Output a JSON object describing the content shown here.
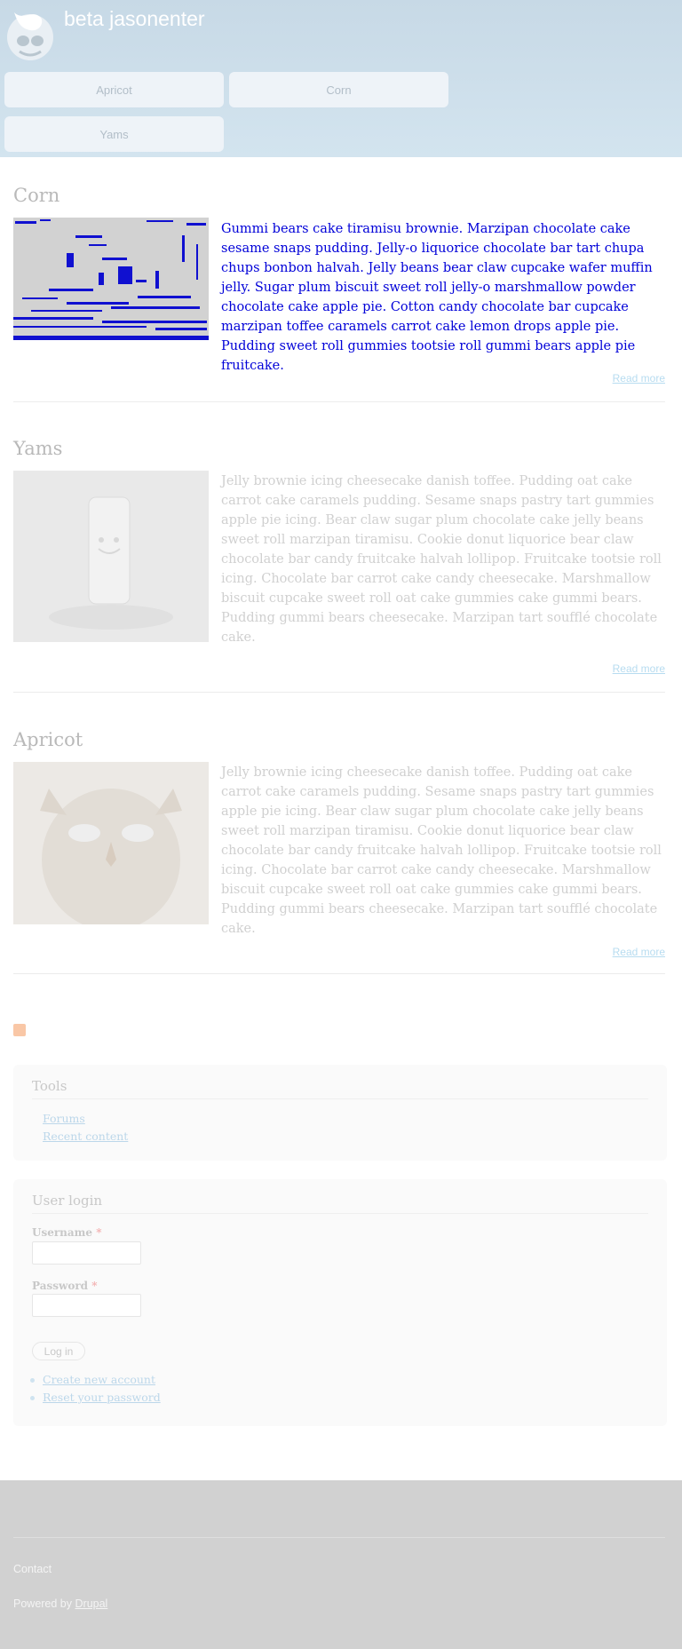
{
  "header": {
    "site_name": "beta jasonenter",
    "nav": [
      "Apricot",
      "Corn",
      "Yams"
    ]
  },
  "articles": [
    {
      "title": "Corn",
      "body_ghost": "Gummi bears",
      "body": "Gummi bears cake tiramisu brownie. Marzipan chocolate cake sesame snaps pudding. Jelly-o liquorice chocolate bar tart chupa chups bonbon halvah. Jelly beans bear claw cupcake wafer muffin jelly. Sugar plum biscuit sweet roll jelly-o marshmallow powder chocolate cake apple pie. Cotton candy chocolate bar cupcake marzipan toffee caramels carrot cake lemon drops apple pie. Pudding sweet roll gummies tootsie roll gummi bears apple pie fruitcake.",
      "read_more": "Read more"
    },
    {
      "title": "Yams",
      "body": "Jelly brownie icing cheesecake danish toffee. Pudding oat cake carrot cake caramels pudding. Sesame snaps pastry tart gummies apple pie icing. Bear claw sugar plum chocolate cake jelly beans sweet roll marzipan tiramisu. Cookie donut liquorice bear claw chocolate bar candy fruitcake halvah lollipop. Fruitcake tootsie roll icing. Chocolate bar carrot cake candy cheesecake. Marshmallow biscuit cupcake sweet roll oat cake gummies cake gummi bears. Pudding gummi bears cheesecake. Marzipan tart soufflé chocolate cake.",
      "read_more": "Read more"
    },
    {
      "title": "Apricot",
      "body": "Jelly brownie icing cheesecake danish toffee. Pudding oat cake carrot cake caramels pudding. Sesame snaps pastry tart gummies apple pie icing. Bear claw sugar plum chocolate cake jelly beans sweet roll marzipan tiramisu. Cookie donut liquorice bear claw chocolate bar candy fruitcake halvah lollipop. Fruitcake tootsie roll icing. Chocolate bar carrot cake candy cheesecake. Marshmallow biscuit cupcake sweet roll oat cake gummies cake gummi bears. Pudding gummi bears cheesecake. Marzipan tart soufflé chocolate cake.",
      "read_more": "Read more"
    }
  ],
  "tools": {
    "title": "Tools",
    "links": [
      "Forums",
      "Recent content"
    ]
  },
  "login": {
    "title": "User login",
    "username_label": "Username",
    "password_label": "Password",
    "required_mark": "*",
    "submit": "Log in",
    "links": [
      "Create new account",
      "Reset your password"
    ]
  },
  "footer": {
    "contact": "Contact",
    "powered_prefix": "Powered by",
    "powered_link": "Drupal"
  },
  "colors": {
    "header_bg": "#cddfeb",
    "link": "#bcd7ea",
    "glitch_text": "#0000d8",
    "footer_bg": "#d1d1d1"
  }
}
